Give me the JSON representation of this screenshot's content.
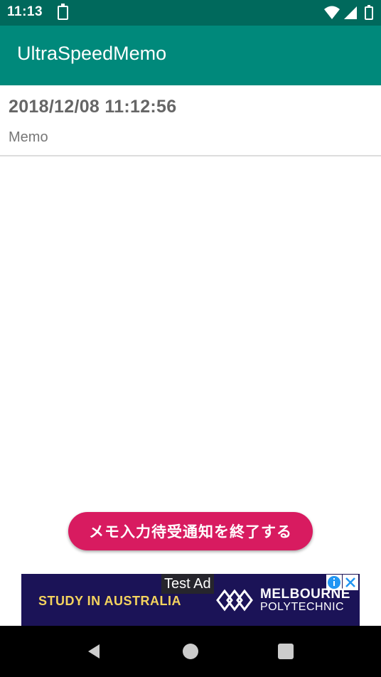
{
  "status_bar": {
    "time": "11:13",
    "icons": [
      "battery-charging-icon",
      "wifi-icon",
      "cellular-signal-icon",
      "battery-charging-icon"
    ]
  },
  "app_bar": {
    "title": "UltraSpeedMemo",
    "color": "#00897b"
  },
  "memo_list": [
    {
      "date": "2018/12/08 11:12:56",
      "text": "Memo"
    }
  ],
  "actions": {
    "end_notification_label": "メモ入力待受通知を終了する",
    "button_color": "#d81b60"
  },
  "ad": {
    "label": "Test Ad",
    "headline": "STUDY IN AUSTRALIA",
    "brand_line1": "MELBOURNE",
    "brand_line2": "POLYTECHNIC"
  },
  "nav_bar": {
    "buttons": [
      "back-icon",
      "home-icon",
      "recents-icon"
    ]
  }
}
